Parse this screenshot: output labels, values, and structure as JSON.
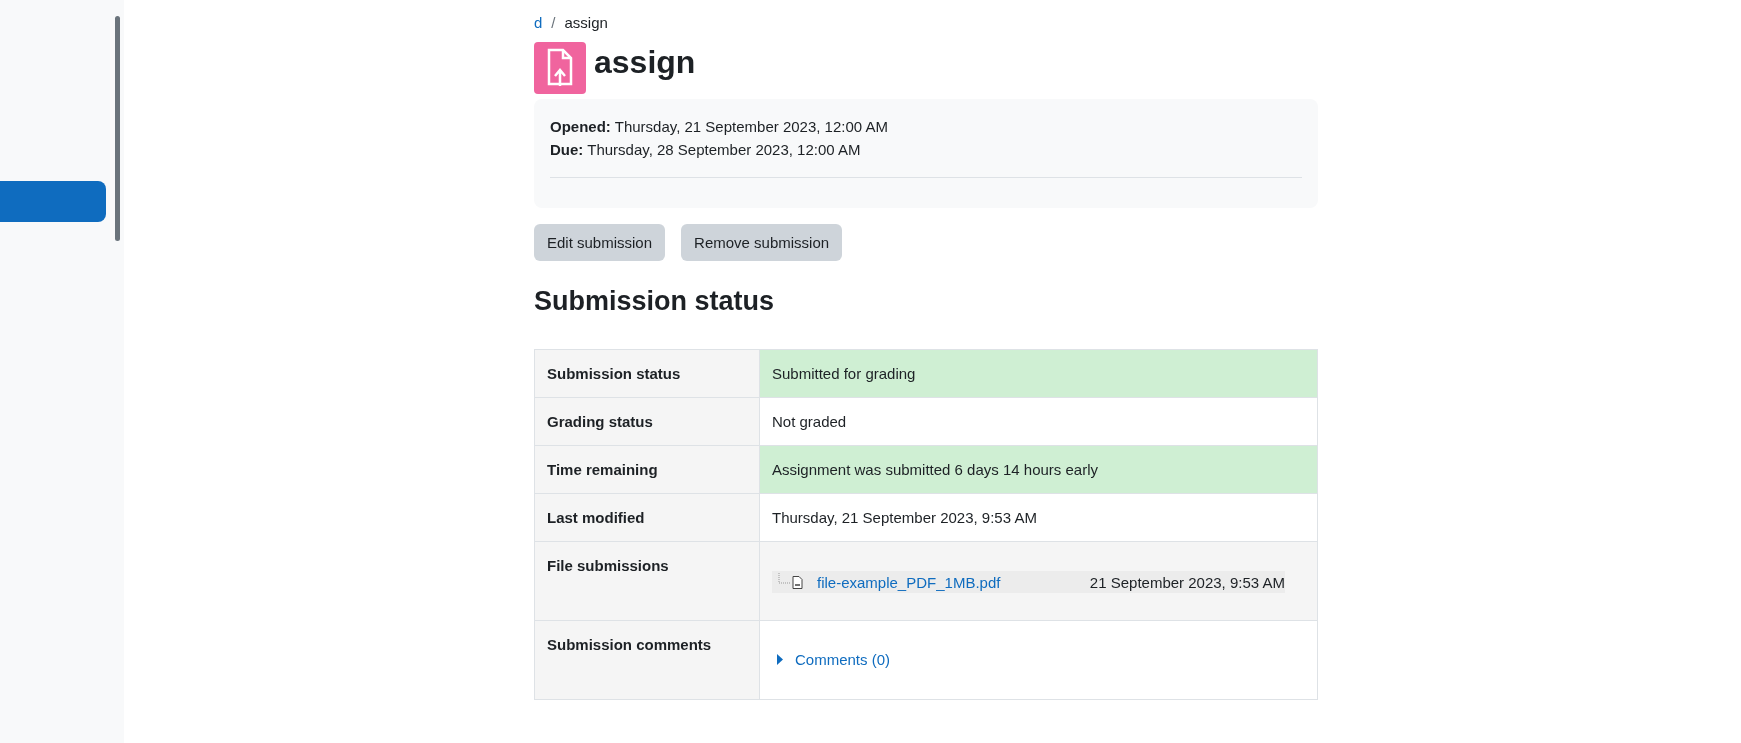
{
  "breadcrumb": [
    {
      "label": "d",
      "current": false
    },
    {
      "label": "assign",
      "current": true
    }
  ],
  "breadcrumb_separator": "/",
  "title": "assign",
  "dates": [
    "**Opened:** Thursday, 21 September 2023, 12:00 AM",
    "**Due:** Thursday, 28 September 2023, 12:00 AM"
  ],
  "buttons": [
    "Edit submission",
    "Remove submission"
  ],
  "section_title": "Submission status",
  "table": {
    "rows": [
      {
        "label": "Submission status",
        "kind": "text",
        "highlighted": true,
        "value": "Submitted for grading"
      },
      {
        "label": "Grading status",
        "kind": "text",
        "highlighted": false,
        "value": "Not graded"
      },
      {
        "label": "Time remaining",
        "kind": "text",
        "highlighted": true,
        "value": "Assignment was submitted 6 days 14 hours early"
      },
      {
        "label": "Last modified",
        "kind": "text",
        "highlighted": false,
        "value": "Thursday, 21 September 2023, 9:53 AM"
      },
      {
        "label": "File submissions",
        "kind": "file",
        "highlighted": false,
        "file": {
          "name": "file-example_PDF_1MB.pdf",
          "date": "21 September 2023, 9:53 AM"
        }
      },
      {
        "label": "Submission comments",
        "kind": "comments",
        "highlighted": false,
        "link": "Comments (0)",
        "expanded": false
      }
    ]
  }
}
